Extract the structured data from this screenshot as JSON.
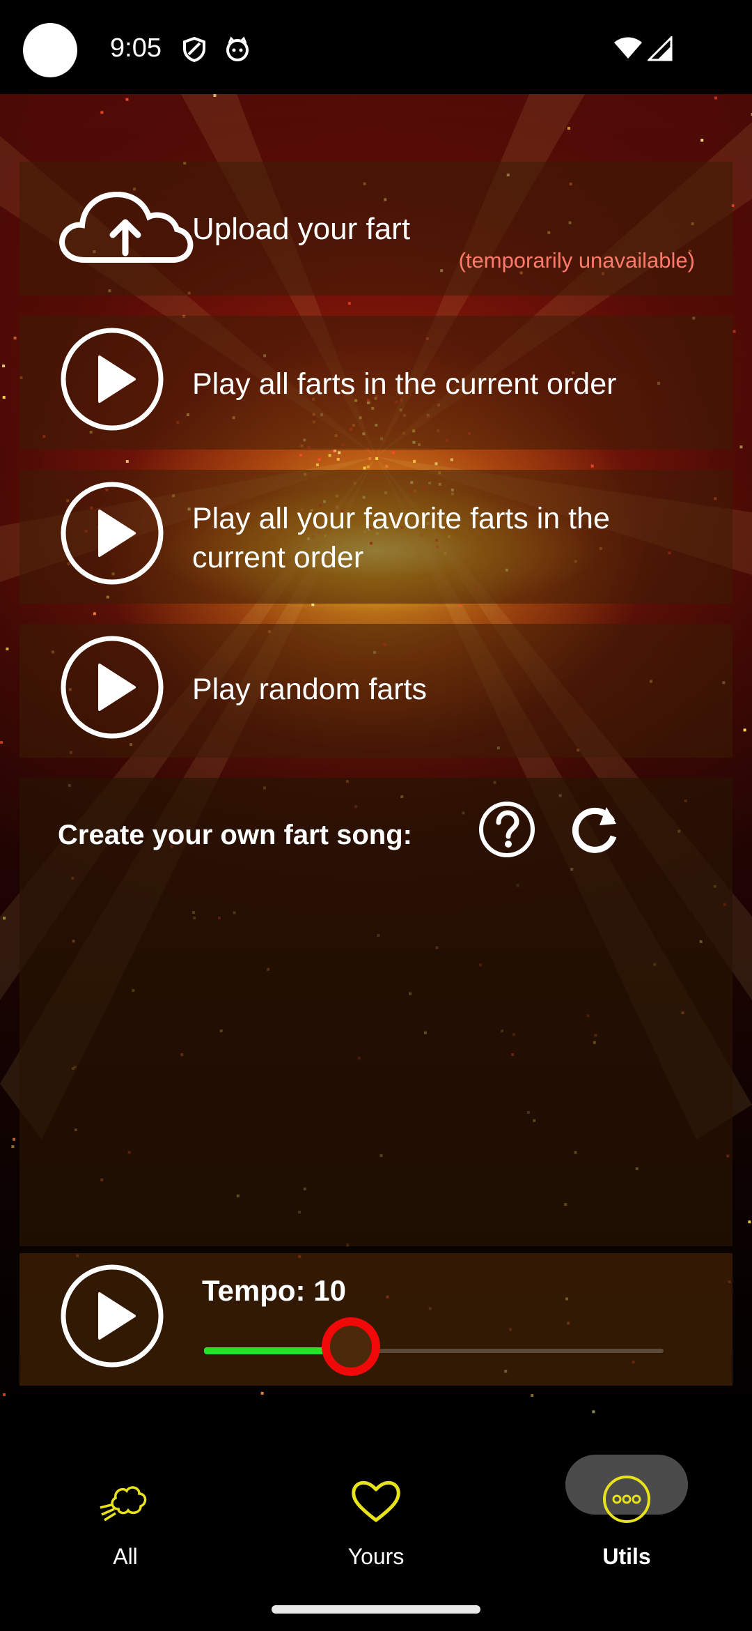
{
  "status_bar": {
    "time": "9:05",
    "icons": [
      "shield-icon",
      "cat-face-icon",
      "wifi-icon",
      "signal-icon"
    ]
  },
  "actions": {
    "upload_label": "Upload your fart",
    "upload_note": "(temporarily unavailable)",
    "play_all_label": "Play all farts in the current order",
    "play_favorites_label_line1": "Play all your favorite farts in the",
    "play_favorites_label_line2": "current order",
    "play_random_label": "Play random farts"
  },
  "song": {
    "title": "Create your own fart song:",
    "tempo_label": "Tempo: 10",
    "tempo_fraction": 0.32
  },
  "bottom_nav": {
    "items": [
      {
        "label": "All",
        "icon": "fart-cloud-icon"
      },
      {
        "label": "Yours",
        "icon": "heart-icon"
      },
      {
        "label": "Utils",
        "icon": "more-dots-icon",
        "selected": true
      }
    ]
  },
  "colors": {
    "accent_yellow": "#e8e21a",
    "note_red": "#ff7a6b",
    "slider_green": "#22e52b",
    "slider_thumb_red": "#f10808",
    "nav_pill": "#4b4b4b"
  }
}
